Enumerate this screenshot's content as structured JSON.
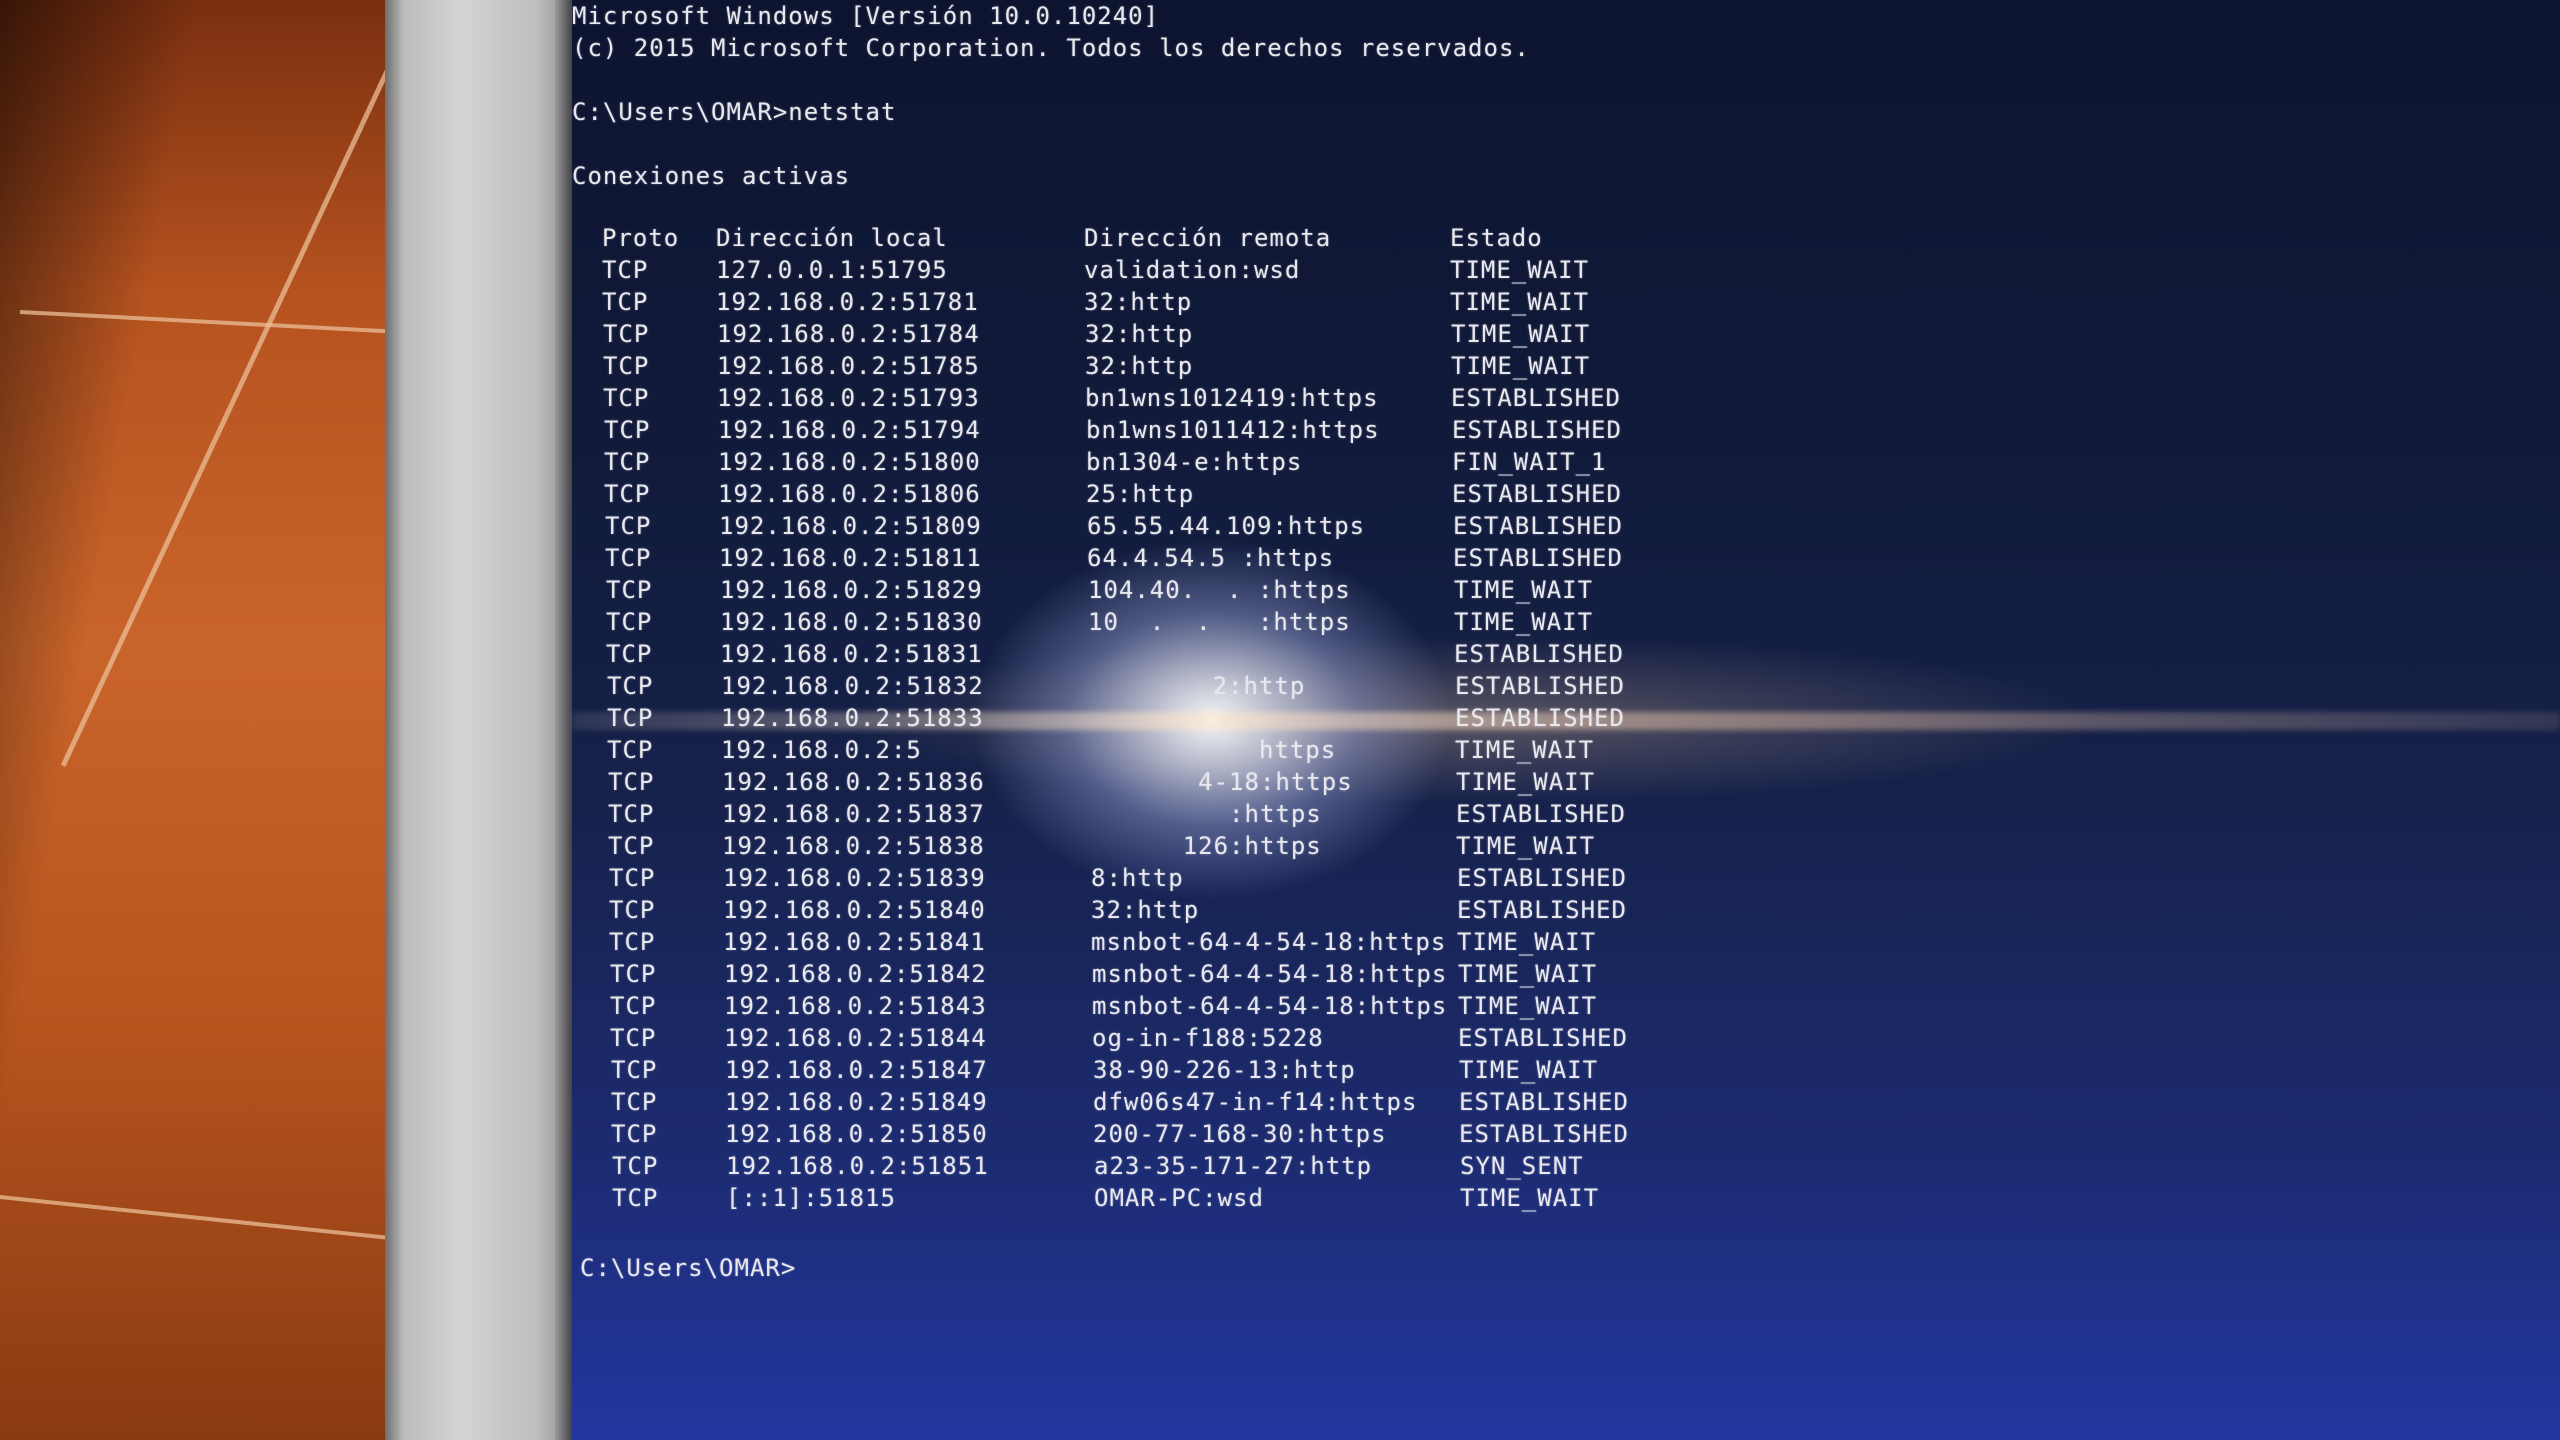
{
  "window": {
    "header_line1": "Microsoft Windows [Versión 10.0.10240]",
    "header_line2": "(c) 2015 Microsoft Corporation. Todos los derechos reservados.",
    "command_prompt": "C:\\Users\\OMAR>netstat",
    "section_title": "Conexiones activas",
    "final_prompt": "C:\\Users\\OMAR>"
  },
  "table": {
    "headers": [
      "Proto",
      "Dirección local",
      "Dirección remota",
      "Estado"
    ],
    "rows": [
      [
        "TCP",
        "127.0.0.1:51795",
        "validation:wsd",
        "TIME_WAIT"
      ],
      [
        "TCP",
        "192.168.0.2:51781",
        "32:http",
        "TIME_WAIT"
      ],
      [
        "TCP",
        "192.168.0.2:51784",
        "32:http",
        "TIME_WAIT"
      ],
      [
        "TCP",
        "192.168.0.2:51785",
        "32:http",
        "TIME_WAIT"
      ],
      [
        "TCP",
        "192.168.0.2:51793",
        "bn1wns1012419:https",
        "ESTABLISHED"
      ],
      [
        "TCP",
        "192.168.0.2:51794",
        "bn1wns1011412:https",
        "ESTABLISHED"
      ],
      [
        "TCP",
        "192.168.0.2:51800",
        "bn1304-e:https",
        "FIN_WAIT_1"
      ],
      [
        "TCP",
        "192.168.0.2:51806",
        "25:http",
        "ESTABLISHED"
      ],
      [
        "TCP",
        "192.168.0.2:51809",
        "65.55.44.109:https",
        "ESTABLISHED"
      ],
      [
        "TCP",
        "192.168.0.2:51811",
        "64.4.54.5 :https",
        "ESTABLISHED"
      ],
      [
        "TCP",
        "192.168.0.2:51829",
        "104.40.  . :https",
        "TIME_WAIT"
      ],
      [
        "TCP",
        "192.168.0.2:51830",
        "10  .  .   :https",
        "TIME_WAIT"
      ],
      [
        "TCP",
        "192.168.0.2:51831",
        "",
        "ESTABLISHED"
      ],
      [
        "TCP",
        "192.168.0.2:51832",
        "        2:http",
        "ESTABLISHED"
      ],
      [
        "TCP",
        "192.168.0.2:51833",
        "",
        "ESTABLISHED"
      ],
      [
        "TCP",
        "192.168.0.2:5",
        "           https",
        "TIME_WAIT"
      ],
      [
        "TCP",
        "192.168.0.2:51836",
        "       4-18:https",
        "TIME_WAIT"
      ],
      [
        "TCP",
        "192.168.0.2:51837",
        "         :https",
        "ESTABLISHED"
      ],
      [
        "TCP",
        "192.168.0.2:51838",
        "      126:https",
        "TIME_WAIT"
      ],
      [
        "TCP",
        "192.168.0.2:51839",
        "8:http",
        "ESTABLISHED"
      ],
      [
        "TCP",
        "192.168.0.2:51840",
        "32:http",
        "ESTABLISHED"
      ],
      [
        "TCP",
        "192.168.0.2:51841",
        "msnbot-64-4-54-18:https",
        "TIME_WAIT"
      ],
      [
        "TCP",
        "192.168.0.2:51842",
        "msnbot-64-4-54-18:https",
        "TIME_WAIT"
      ],
      [
        "TCP",
        "192.168.0.2:51843",
        "msnbot-64-4-54-18:https",
        "TIME_WAIT"
      ],
      [
        "TCP",
        "192.168.0.2:51844",
        "og-in-f188:5228",
        "ESTABLISHED"
      ],
      [
        "TCP",
        "192.168.0.2:51847",
        "38-90-226-13:http",
        "TIME_WAIT"
      ],
      [
        "TCP",
        "192.168.0.2:51849",
        "dfw06s47-in-f14:https",
        "ESTABLISHED"
      ],
      [
        "TCP",
        "192.168.0.2:51850",
        "200-77-168-30:https",
        "ESTABLISHED"
      ],
      [
        "TCP",
        "192.168.0.2:51851",
        "a23-35-171-27:http",
        "SYN_SENT"
      ],
      [
        "TCP",
        "[::1]:51815",
        "OMAR-PC:wsd",
        "TIME_WAIT"
      ]
    ]
  },
  "colors": {
    "console_text": "#e8e8ee",
    "screen_top": "#0d1430",
    "screen_bottom": "#2236a0",
    "floor": "#c9642a",
    "bezel": "#d4d4d2"
  }
}
